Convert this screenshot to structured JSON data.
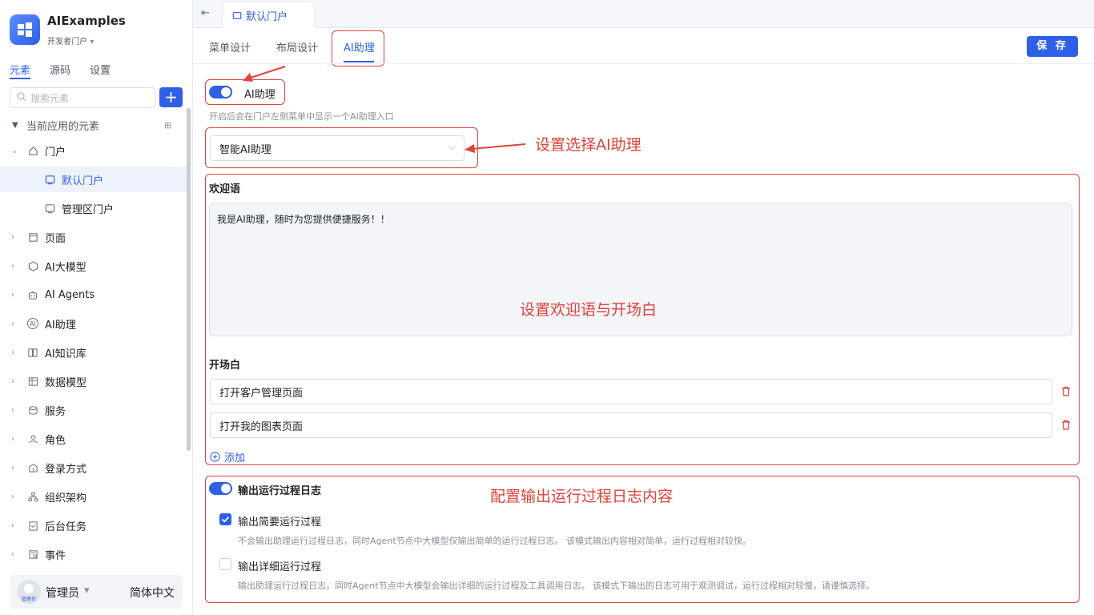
{
  "app": {
    "name": "AIExamples",
    "portal": "开发者门户"
  },
  "sidebar": {
    "tabs": [
      "元素",
      "源码",
      "设置"
    ],
    "search_placeholder": "搜索元素",
    "section": "当前应用的元素",
    "items": [
      {
        "label": "门户",
        "icon": "home-icon"
      },
      {
        "label": "默认门户",
        "icon": "portal-icon"
      },
      {
        "label": "管理区门户",
        "icon": "portal-icon"
      },
      {
        "label": "页面",
        "icon": "page-icon"
      },
      {
        "label": "AI大模型",
        "icon": "cube-icon"
      },
      {
        "label": "AI Agents",
        "icon": "robot-icon"
      },
      {
        "label": "AI助理",
        "icon": "ai-icon"
      },
      {
        "label": "AI知识库",
        "icon": "book-icon"
      },
      {
        "label": "数据模型",
        "icon": "table-icon"
      },
      {
        "label": "服务",
        "icon": "service-icon"
      },
      {
        "label": "角色",
        "icon": "role-icon"
      },
      {
        "label": "登录方式",
        "icon": "login-icon"
      },
      {
        "label": "组织架构",
        "icon": "org-icon"
      },
      {
        "label": "后台任务",
        "icon": "task-icon"
      },
      {
        "label": "事件",
        "icon": "event-icon"
      }
    ],
    "user": {
      "name": "管理员",
      "avatar_text": "管理员",
      "language": "简体中文"
    }
  },
  "header": {
    "tab": "默认门户",
    "subtabs": [
      "菜单设计",
      "布局设计",
      "AI助理"
    ],
    "save": "保 存"
  },
  "assistant": {
    "toggle_label": "AI助理",
    "toggle_hint": "开启后会在门户左侧菜单中显示一个AI助理入口",
    "select_value": "智能AI助理",
    "welcome_label": "欢迎语",
    "welcome_text": "我是AI助理，随时为您提供便捷服务！！",
    "opening_label": "开场白",
    "openings": [
      "打开客户管理页面",
      "打开我的图表页面"
    ],
    "add_label": "添加",
    "log_label": "输出运行过程日志",
    "brief_label": "输出简要运行过程",
    "brief_desc": "不会输出助理运行过程日志，同时Agent节点中大模型仅输出简单的运行过程日志。 该模式输出内容相对简单，运行过程相对较快。",
    "detail_label": "输出详细运行过程",
    "detail_desc": "输出助理运行过程日志，同时Agent节点中大模型会输出详细的运行过程及工具调用日志。 该模式下输出的日志可用于观测调试，运行过程相对较慢，请谨慎选择。"
  },
  "annotations": {
    "select": "设置选择AI助理",
    "welcome": "设置欢迎语与开场白",
    "log": "配置输出运行过程日志内容"
  },
  "colors": {
    "accent": "#2f5fe6",
    "annotation": "#e0423c"
  }
}
